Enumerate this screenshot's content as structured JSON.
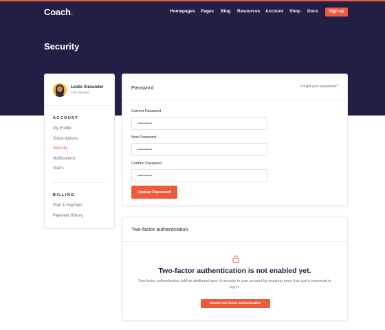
{
  "brand": {
    "name": "Coach",
    "dot": ".",
    "accent_color": "#ef5a3c",
    "hero_color": "#221f45"
  },
  "nav": {
    "links": [
      "Homepages",
      "Pages",
      "Blog",
      "Resources",
      "Account",
      "Shop",
      "Docs"
    ],
    "signup_label": "Sign up"
  },
  "page": {
    "title": "Security"
  },
  "sidebar": {
    "user": {
      "name": "Leslie Alexander",
      "role": "Free Member"
    },
    "sections": [
      {
        "heading": "ACCOUNT",
        "items": [
          "My Profile",
          "Subscriptions",
          "Security",
          "Notifications",
          "Users"
        ],
        "active": "Security"
      },
      {
        "heading": "BILLING",
        "items": [
          "Plan & Payment",
          "Payment History"
        ]
      }
    ]
  },
  "password_card": {
    "title": "Password",
    "forgot_link": "Forgot your password?",
    "fields": [
      {
        "label": "Current Password",
        "value": "••••••••••••"
      },
      {
        "label": "New Password",
        "value": "••••••••••••"
      },
      {
        "label": "Confirm Password",
        "value": "••••••••••••"
      }
    ],
    "submit_label": "Update Password"
  },
  "two_factor_card": {
    "title": "Two-factor authentication",
    "icon": "lock-icon",
    "headline": "Two-factor authentication is not enabled yet.",
    "description": "Two-factor authentication add an additional layer of security to your account by requiring more than just a password to log in.",
    "button_label": "Enable two-factor authentication"
  }
}
